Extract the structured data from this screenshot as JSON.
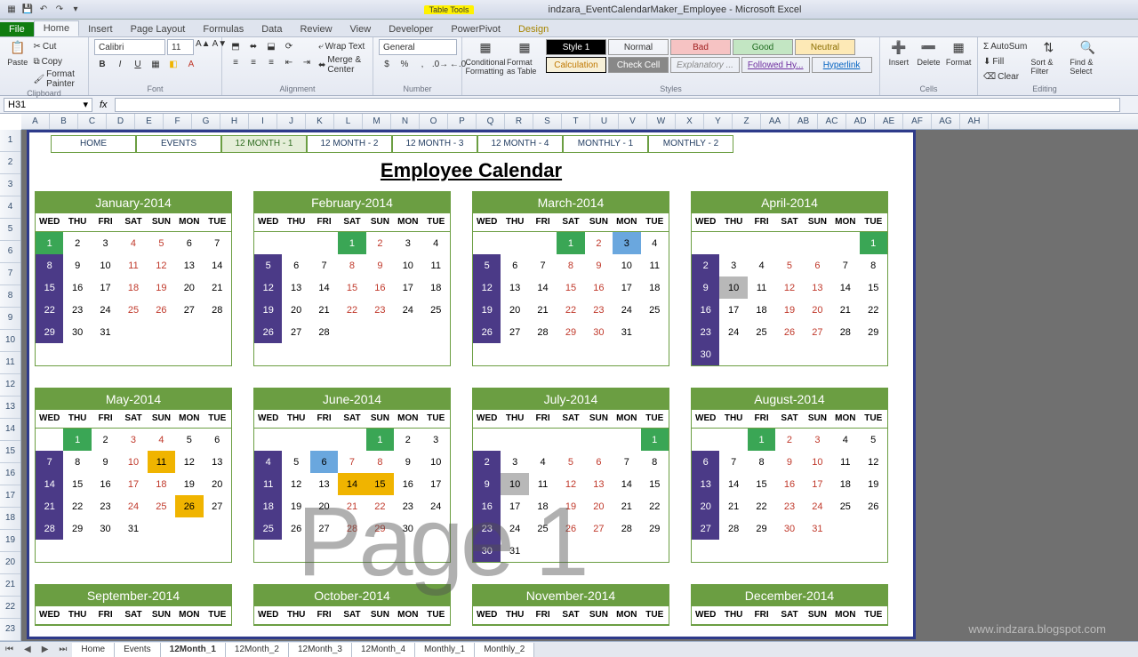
{
  "app": {
    "title": "indzara_EventCalendarMaker_Employee - Microsoft Excel",
    "tabletools": "Table Tools"
  },
  "ribbonTabs": [
    "File",
    "Home",
    "Insert",
    "Page Layout",
    "Formulas",
    "Data",
    "Review",
    "View",
    "Developer",
    "PowerPivot",
    "Design"
  ],
  "clipboard": {
    "paste": "Paste",
    "cut": "Cut",
    "copy": "Copy",
    "formatPainter": "Format Painter",
    "label": "Clipboard"
  },
  "font": {
    "name": "Calibri",
    "size": "11",
    "label": "Font"
  },
  "alignment": {
    "wrap": "Wrap Text",
    "merge": "Merge & Center",
    "label": "Alignment"
  },
  "number": {
    "format": "General",
    "label": "Number"
  },
  "styles": {
    "cond": "Conditional Formatting",
    "table": "Format as Table",
    "style1": "Style 1",
    "normal": "Normal",
    "bad": "Bad",
    "good": "Good",
    "neutral": "Neutral",
    "calc": "Calculation",
    "check": "Check Cell",
    "explan": "Explanatory ...",
    "followed": "Followed Hy...",
    "hyper": "Hyperlink",
    "label": "Styles"
  },
  "cells": {
    "insert": "Insert",
    "delete": "Delete",
    "format": "Format",
    "label": "Cells"
  },
  "editing": {
    "autosum": "AutoSum",
    "fill": "Fill",
    "clear": "Clear",
    "sort": "Sort & Filter",
    "find": "Find & Select",
    "label": "Editing"
  },
  "nameBox": "H31",
  "cols": [
    "A",
    "B",
    "C",
    "D",
    "E",
    "F",
    "G",
    "H",
    "I",
    "J",
    "K",
    "L",
    "M",
    "N",
    "O",
    "P",
    "Q",
    "R",
    "S",
    "T",
    "U",
    "V",
    "W",
    "X",
    "Y",
    "Z",
    "AA",
    "AB",
    "AC",
    "AD",
    "AE",
    "AF",
    "AG",
    "AH"
  ],
  "rows": [
    "1",
    "2",
    "3",
    "4",
    "5",
    "6",
    "7",
    "8",
    "9",
    "10",
    "11",
    "12",
    "13",
    "14",
    "15",
    "16",
    "17",
    "18",
    "19",
    "20",
    "21",
    "22",
    "23"
  ],
  "nav": [
    "HOME",
    "EVENTS",
    "12 MONTH - 1",
    "12 MONTH - 2",
    "12 MONTH - 3",
    "12 MONTH - 4",
    "MONTHLY - 1",
    "MONTHLY - 2"
  ],
  "navActiveIndex": 2,
  "calTitle": "Employee Calendar",
  "dayHeads": [
    "WED",
    "THU",
    "FRI",
    "SAT",
    "SUN",
    "MON",
    "TUE"
  ],
  "sheetTabs": [
    "Home",
    "Events",
    "12Month_1",
    "12Month_2",
    "12Month_3",
    "12Month_4",
    "Monthly_1",
    "Monthly_2"
  ],
  "sheetActiveIndex": 2,
  "watermark": "Page 1",
  "wmurl": "www.indzara.blogspot.com",
  "months": [
    {
      "name": "January-2014",
      "weeks": [
        [
          {
            "d": 1,
            "c": "grn"
          },
          {
            "d": 2
          },
          {
            "d": 3
          },
          {
            "d": 4,
            "we": 1
          },
          {
            "d": 5,
            "we": 1
          },
          {
            "d": 6
          },
          {
            "d": 7
          }
        ],
        [
          {
            "d": 8,
            "c": "wk"
          },
          {
            "d": 9
          },
          {
            "d": 10
          },
          {
            "d": 11,
            "we": 1
          },
          {
            "d": 12,
            "we": 1
          },
          {
            "d": 13
          },
          {
            "d": 14
          }
        ],
        [
          {
            "d": 15,
            "c": "wk"
          },
          {
            "d": 16
          },
          {
            "d": 17
          },
          {
            "d": 18,
            "we": 1
          },
          {
            "d": 19,
            "we": 1
          },
          {
            "d": 20
          },
          {
            "d": 21
          }
        ],
        [
          {
            "d": 22,
            "c": "wk"
          },
          {
            "d": 23
          },
          {
            "d": 24
          },
          {
            "d": 25,
            "we": 1
          },
          {
            "d": 26,
            "we": 1
          },
          {
            "d": 27
          },
          {
            "d": 28
          }
        ],
        [
          {
            "d": 29,
            "c": "wk"
          },
          {
            "d": 30
          },
          {
            "d": 31
          },
          {},
          {},
          {},
          {}
        ]
      ]
    },
    {
      "name": "February-2014",
      "weeks": [
        [
          {},
          {},
          {},
          {
            "d": 1,
            "c": "grn"
          },
          {
            "d": 2,
            "we": 1
          },
          {
            "d": 3
          },
          {
            "d": 4
          }
        ],
        [
          {
            "d": 5,
            "c": "wk"
          },
          {
            "d": 6
          },
          {
            "d": 7
          },
          {
            "d": 8,
            "we": 1
          },
          {
            "d": 9,
            "we": 1
          },
          {
            "d": 10
          },
          {
            "d": 11
          }
        ],
        [
          {
            "d": 12,
            "c": "wk"
          },
          {
            "d": 13
          },
          {
            "d": 14
          },
          {
            "d": 15,
            "we": 1
          },
          {
            "d": 16,
            "we": 1
          },
          {
            "d": 17
          },
          {
            "d": 18
          }
        ],
        [
          {
            "d": 19,
            "c": "wk"
          },
          {
            "d": 20
          },
          {
            "d": 21
          },
          {
            "d": 22,
            "we": 1
          },
          {
            "d": 23,
            "we": 1
          },
          {
            "d": 24
          },
          {
            "d": 25
          }
        ],
        [
          {
            "d": 26,
            "c": "wk"
          },
          {
            "d": 27
          },
          {
            "d": 28
          },
          {},
          {},
          {},
          {}
        ]
      ]
    },
    {
      "name": "March-2014",
      "weeks": [
        [
          {},
          {},
          {},
          {
            "d": 1,
            "c": "grn"
          },
          {
            "d": 2,
            "we": 1
          },
          {
            "d": 3,
            "c": "blu"
          },
          {
            "d": 4
          }
        ],
        [
          {
            "d": 5,
            "c": "wk"
          },
          {
            "d": 6
          },
          {
            "d": 7
          },
          {
            "d": 8,
            "we": 1
          },
          {
            "d": 9,
            "we": 1
          },
          {
            "d": 10
          },
          {
            "d": 11
          }
        ],
        [
          {
            "d": 12,
            "c": "wk"
          },
          {
            "d": 13
          },
          {
            "d": 14
          },
          {
            "d": 15,
            "we": 1
          },
          {
            "d": 16,
            "we": 1
          },
          {
            "d": 17
          },
          {
            "d": 18
          }
        ],
        [
          {
            "d": 19,
            "c": "wk"
          },
          {
            "d": 20
          },
          {
            "d": 21
          },
          {
            "d": 22,
            "we": 1
          },
          {
            "d": 23,
            "we": 1
          },
          {
            "d": 24
          },
          {
            "d": 25
          }
        ],
        [
          {
            "d": 26,
            "c": "wk"
          },
          {
            "d": 27
          },
          {
            "d": 28
          },
          {
            "d": 29,
            "we": 1
          },
          {
            "d": 30,
            "we": 1
          },
          {
            "d": 31
          },
          {}
        ]
      ]
    },
    {
      "name": "April-2014",
      "weeks": [
        [
          {},
          {},
          {},
          {},
          {},
          {},
          {
            "d": 1,
            "c": "grn"
          }
        ],
        [
          {
            "d": 2,
            "c": "wk"
          },
          {
            "d": 3
          },
          {
            "d": 4
          },
          {
            "d": 5,
            "we": 1
          },
          {
            "d": 6,
            "we": 1
          },
          {
            "d": 7
          },
          {
            "d": 8
          }
        ],
        [
          {
            "d": 9,
            "c": "wk"
          },
          {
            "d": 10,
            "c": "gry"
          },
          {
            "d": 11
          },
          {
            "d": 12,
            "we": 1
          },
          {
            "d": 13,
            "we": 1
          },
          {
            "d": 14
          },
          {
            "d": 15
          }
        ],
        [
          {
            "d": 16,
            "c": "wk"
          },
          {
            "d": 17
          },
          {
            "d": 18
          },
          {
            "d": 19,
            "we": 1
          },
          {
            "d": 20,
            "we": 1
          },
          {
            "d": 21
          },
          {
            "d": 22
          }
        ],
        [
          {
            "d": 23,
            "c": "wk"
          },
          {
            "d": 24
          },
          {
            "d": 25
          },
          {
            "d": 26,
            "we": 1
          },
          {
            "d": 27,
            "we": 1
          },
          {
            "d": 28
          },
          {
            "d": 29
          }
        ],
        [
          {
            "d": 30,
            "c": "wk"
          },
          {},
          {},
          {},
          {},
          {},
          {}
        ]
      ]
    },
    {
      "name": "May-2014",
      "weeks": [
        [
          {},
          {
            "d": 1,
            "c": "grn"
          },
          {
            "d": 2
          },
          {
            "d": 3,
            "we": 1
          },
          {
            "d": 4,
            "we": 1
          },
          {
            "d": 5
          },
          {
            "d": 6
          }
        ],
        [
          {
            "d": 7,
            "c": "wk"
          },
          {
            "d": 8
          },
          {
            "d": 9
          },
          {
            "d": 10,
            "we": 1
          },
          {
            "d": 11,
            "c": "yel"
          },
          {
            "d": 12
          },
          {
            "d": 13
          }
        ],
        [
          {
            "d": 14,
            "c": "wk"
          },
          {
            "d": 15
          },
          {
            "d": 16
          },
          {
            "d": 17,
            "we": 1
          },
          {
            "d": 18,
            "we": 1
          },
          {
            "d": 19
          },
          {
            "d": 20
          }
        ],
        [
          {
            "d": 21,
            "c": "wk"
          },
          {
            "d": 22
          },
          {
            "d": 23
          },
          {
            "d": 24,
            "we": 1
          },
          {
            "d": 25,
            "we": 1
          },
          {
            "d": 26,
            "c": "yel"
          },
          {
            "d": 27
          }
        ],
        [
          {
            "d": 28,
            "c": "wk"
          },
          {
            "d": 29
          },
          {
            "d": 30
          },
          {
            "d": 31
          },
          {},
          {},
          {}
        ]
      ]
    },
    {
      "name": "June-2014",
      "weeks": [
        [
          {},
          {},
          {},
          {},
          {
            "d": 1,
            "c": "grn"
          },
          {
            "d": 2
          },
          {
            "d": 3
          }
        ],
        [
          {
            "d": 4,
            "c": "wk"
          },
          {
            "d": 5
          },
          {
            "d": 6,
            "c": "blu"
          },
          {
            "d": 7,
            "we": 1
          },
          {
            "d": 8,
            "we": 1
          },
          {
            "d": 9
          },
          {
            "d": 10
          }
        ],
        [
          {
            "d": 11,
            "c": "wk"
          },
          {
            "d": 12
          },
          {
            "d": 13
          },
          {
            "d": 14,
            "c": "yel"
          },
          {
            "d": 15,
            "c": "yel"
          },
          {
            "d": 16
          },
          {
            "d": 17
          }
        ],
        [
          {
            "d": 18,
            "c": "wk"
          },
          {
            "d": 19
          },
          {
            "d": 20
          },
          {
            "d": 21,
            "we": 1
          },
          {
            "d": 22,
            "we": 1
          },
          {
            "d": 23
          },
          {
            "d": 24
          }
        ],
        [
          {
            "d": 25,
            "c": "wk"
          },
          {
            "d": 26
          },
          {
            "d": 27
          },
          {
            "d": 28,
            "we": 1
          },
          {
            "d": 29,
            "we": 1
          },
          {
            "d": 30
          },
          {}
        ]
      ]
    },
    {
      "name": "July-2014",
      "weeks": [
        [
          {},
          {},
          {},
          {},
          {},
          {},
          {
            "d": 1,
            "c": "grn"
          }
        ],
        [
          {
            "d": 2,
            "c": "wk"
          },
          {
            "d": 3
          },
          {
            "d": 4
          },
          {
            "d": 5,
            "we": 1
          },
          {
            "d": 6,
            "we": 1
          },
          {
            "d": 7
          },
          {
            "d": 8
          }
        ],
        [
          {
            "d": 9,
            "c": "wk"
          },
          {
            "d": 10,
            "c": "gry"
          },
          {
            "d": 11
          },
          {
            "d": 12,
            "we": 1
          },
          {
            "d": 13,
            "we": 1
          },
          {
            "d": 14
          },
          {
            "d": 15
          }
        ],
        [
          {
            "d": 16,
            "c": "wk"
          },
          {
            "d": 17
          },
          {
            "d": 18
          },
          {
            "d": 19,
            "we": 1
          },
          {
            "d": 20,
            "we": 1
          },
          {
            "d": 21
          },
          {
            "d": 22
          }
        ],
        [
          {
            "d": 23,
            "c": "wk"
          },
          {
            "d": 24
          },
          {
            "d": 25
          },
          {
            "d": 26,
            "we": 1
          },
          {
            "d": 27,
            "we": 1
          },
          {
            "d": 28
          },
          {
            "d": 29
          }
        ],
        [
          {
            "d": 30,
            "c": "wk"
          },
          {
            "d": 31
          },
          {},
          {},
          {},
          {},
          {}
        ]
      ]
    },
    {
      "name": "August-2014",
      "weeks": [
        [
          {},
          {},
          {
            "d": 1,
            "c": "grn"
          },
          {
            "d": 2,
            "we": 1
          },
          {
            "d": 3,
            "we": 1
          },
          {
            "d": 4
          },
          {
            "d": 5
          }
        ],
        [
          {
            "d": 6,
            "c": "wk"
          },
          {
            "d": 7
          },
          {
            "d": 8
          },
          {
            "d": 9,
            "we": 1
          },
          {
            "d": 10,
            "we": 1
          },
          {
            "d": 11
          },
          {
            "d": 12
          }
        ],
        [
          {
            "d": 13,
            "c": "wk"
          },
          {
            "d": 14
          },
          {
            "d": 15
          },
          {
            "d": 16,
            "we": 1
          },
          {
            "d": 17,
            "we": 1
          },
          {
            "d": 18
          },
          {
            "d": 19
          }
        ],
        [
          {
            "d": 20,
            "c": "wk"
          },
          {
            "d": 21
          },
          {
            "d": 22
          },
          {
            "d": 23,
            "we": 1
          },
          {
            "d": 24,
            "we": 1
          },
          {
            "d": 25
          },
          {
            "d": 26
          }
        ],
        [
          {
            "d": 27,
            "c": "wk"
          },
          {
            "d": 28
          },
          {
            "d": 29
          },
          {
            "d": 30,
            "we": 1
          },
          {
            "d": 31,
            "we": 1
          },
          {},
          {}
        ]
      ]
    },
    {
      "name": "September-2014",
      "weeks": []
    },
    {
      "name": "October-2014",
      "weeks": []
    },
    {
      "name": "November-2014",
      "weeks": []
    },
    {
      "name": "December-2014",
      "weeks": []
    }
  ]
}
